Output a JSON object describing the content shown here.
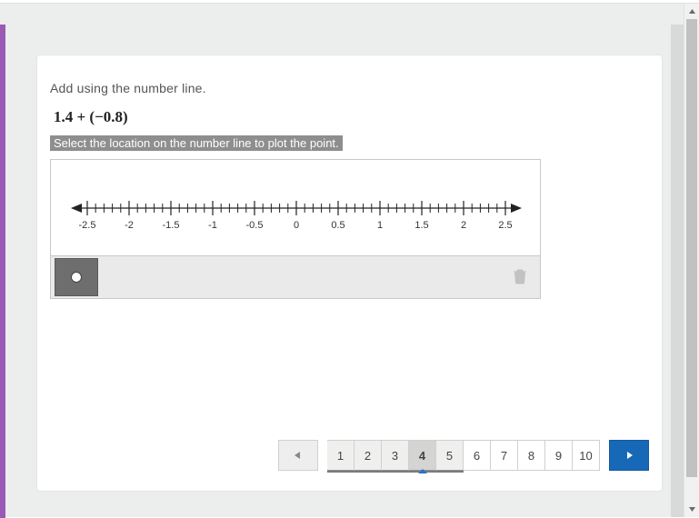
{
  "question": {
    "prompt": "Add using the number line.",
    "expression": "1.4 + (−0.8)",
    "instruction": "Select the location on the number line to plot the point."
  },
  "numberline": {
    "min": -2.5,
    "max": 2.5,
    "major_step": 0.5,
    "labels": [
      "-2.5",
      "-2",
      "-1.5",
      "-1",
      "-0.5",
      "0",
      "0.5",
      "1",
      "1.5",
      "2",
      "2.5"
    ]
  },
  "toolbar": {
    "point_tool": "point",
    "trash": "delete"
  },
  "pager": {
    "prev": "◄",
    "next": "►",
    "pages": [
      "1",
      "2",
      "3",
      "4",
      "5",
      "6",
      "7",
      "8",
      "9",
      "10"
    ],
    "active_index": 3,
    "visited_upto_index": 4
  },
  "colors": {
    "accent": "#9b59b6",
    "primary": "#1868b8"
  }
}
